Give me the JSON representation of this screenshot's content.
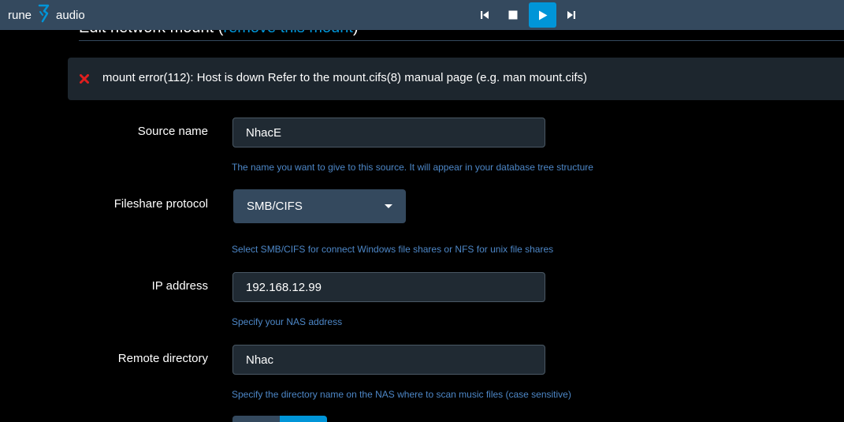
{
  "app": {
    "logo_left": "rune",
    "logo_right": "audio",
    "accent_color": "#0095d8",
    "topbar_color": "#34495e"
  },
  "player": {
    "controls": [
      {
        "name": "previous",
        "icon": "skip-previous-icon"
      },
      {
        "name": "stop",
        "icon": "stop-icon"
      },
      {
        "name": "play",
        "icon": "play-icon",
        "active": true
      },
      {
        "name": "next",
        "icon": "skip-next-icon"
      }
    ]
  },
  "page": {
    "title": "Edit network mount (",
    "remove_link": "remove this mount",
    "title_end": ")"
  },
  "alert": {
    "message": "mount error(112): Host is down Refer to the mount.cifs(8) manual page (e.g. man mount.cifs)"
  },
  "form": {
    "source_name": {
      "label": "Source name",
      "value": "NhacE",
      "help": "The name you want to give to this source. It will appear in your database tree structure"
    },
    "protocol": {
      "label": "Fileshare protocol",
      "value": "SMB/CIFS",
      "help": "Select SMB/CIFS for connect Windows file shares or NFS for unix file shares"
    },
    "ip_address": {
      "label": "IP address",
      "value": "192.168.12.99",
      "help": "Specify your NAS address"
    },
    "remote_dir": {
      "label": "Remote directory",
      "value": "Nhac",
      "help": "Specify the directory name on the NAS where to scan music files (case sensitive)"
    }
  }
}
